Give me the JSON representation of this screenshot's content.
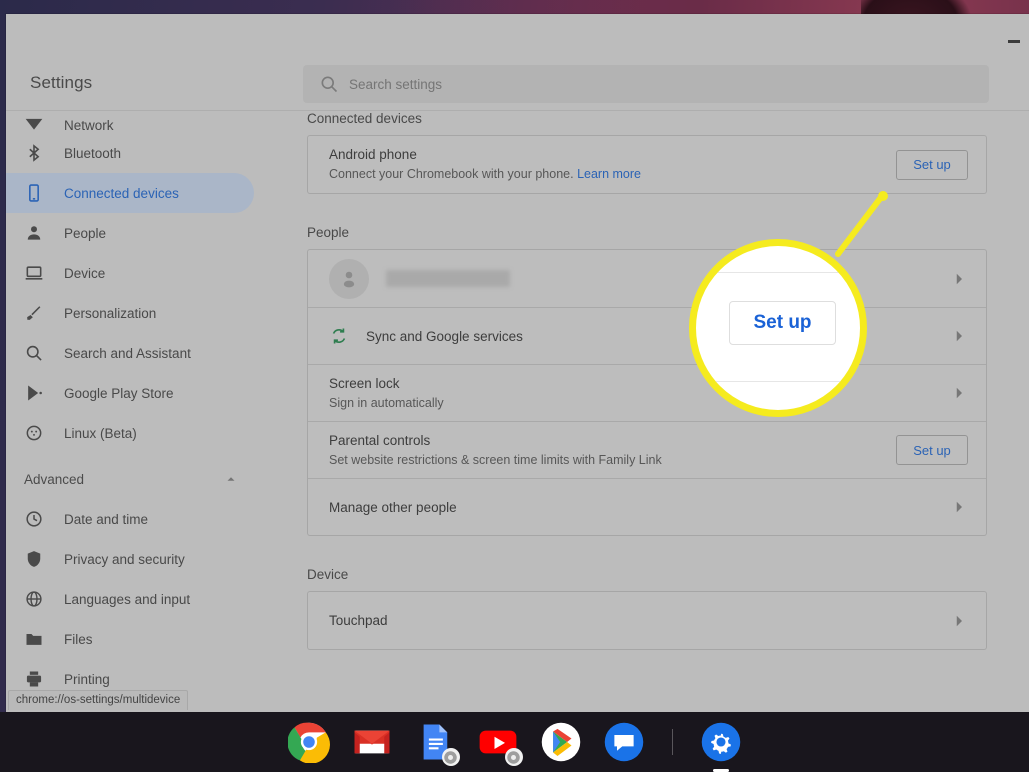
{
  "window": {
    "minimize_label": "minimize",
    "status_url": "chrome://os-settings/multidevice"
  },
  "header": {
    "title": "Settings",
    "search_placeholder": "Search settings",
    "search_value": ""
  },
  "sidebar": {
    "items": [
      {
        "label": "Network",
        "icon": "network-icon",
        "selected": false,
        "clipped": true
      },
      {
        "label": "Bluetooth",
        "icon": "bluetooth-icon",
        "selected": false
      },
      {
        "label": "Connected devices",
        "icon": "phone-icon",
        "selected": true
      },
      {
        "label": "People",
        "icon": "person-icon",
        "selected": false
      },
      {
        "label": "Device",
        "icon": "laptop-icon",
        "selected": false
      },
      {
        "label": "Personalization",
        "icon": "brush-icon",
        "selected": false
      },
      {
        "label": "Search and Assistant",
        "icon": "search-icon",
        "selected": false
      },
      {
        "label": "Google Play Store",
        "icon": "play-store-icon",
        "selected": false
      },
      {
        "label": "Linux (Beta)",
        "icon": "linux-penguin-icon",
        "selected": false
      }
    ],
    "advanced": {
      "label": "Advanced",
      "expanded": true,
      "icon": "chevron-up-icon"
    },
    "advanced_items": [
      {
        "label": "Date and time",
        "icon": "clock-icon"
      },
      {
        "label": "Privacy and security",
        "icon": "shield-icon"
      },
      {
        "label": "Languages and input",
        "icon": "globe-icon"
      },
      {
        "label": "Files",
        "icon": "folder-icon"
      },
      {
        "label": "Printing",
        "icon": "printer-icon"
      }
    ]
  },
  "main": {
    "connected_devices": {
      "title": "Connected devices",
      "android_phone": {
        "primary": "Android phone",
        "secondary": "Connect your Chromebook with your phone.",
        "link": "Learn more",
        "action": "Set up"
      }
    },
    "people": {
      "title": "People",
      "account_row": {
        "name_redacted": true,
        "chevron": "chevron-right-icon"
      },
      "sync_row": {
        "primary": "Sync and Google services",
        "icon": "sync-icon",
        "chevron": "chevron-right-icon"
      },
      "screen_lock_row": {
        "primary": "Screen lock",
        "secondary": "Sign in automatically",
        "chevron": "chevron-right-icon"
      },
      "parental_row": {
        "primary": "Parental controls",
        "secondary": "Set website restrictions & screen time limits with Family Link",
        "action": "Set up"
      },
      "manage_row": {
        "primary": "Manage other people",
        "chevron": "chevron-right-icon"
      }
    },
    "device": {
      "title": "Device",
      "touchpad_row": {
        "primary": "Touchpad",
        "chevron": "chevron-right-icon"
      }
    }
  },
  "callout": {
    "magnified_label": "Set up",
    "ring_color": "#f5eb1e",
    "target": "android-phone-set-up-button"
  },
  "shelf": {
    "items": [
      {
        "name": "chrome-icon",
        "label": "Chrome"
      },
      {
        "name": "gmail-icon",
        "label": "Gmail"
      },
      {
        "name": "google-docs-icon",
        "label": "Docs"
      },
      {
        "name": "youtube-icon",
        "label": "YouTube"
      },
      {
        "name": "play-store-icon",
        "label": "Play Store"
      },
      {
        "name": "messages-icon",
        "label": "Messages"
      },
      {
        "name": "settings-gear-icon",
        "label": "Settings",
        "active": true
      }
    ]
  },
  "colors": {
    "accent_blue": "#2b63b5",
    "highlight_yellow": "#f5eb1e",
    "selected_nav_bg": "#aab6c8",
    "sync_green": "#2e7d4f"
  }
}
